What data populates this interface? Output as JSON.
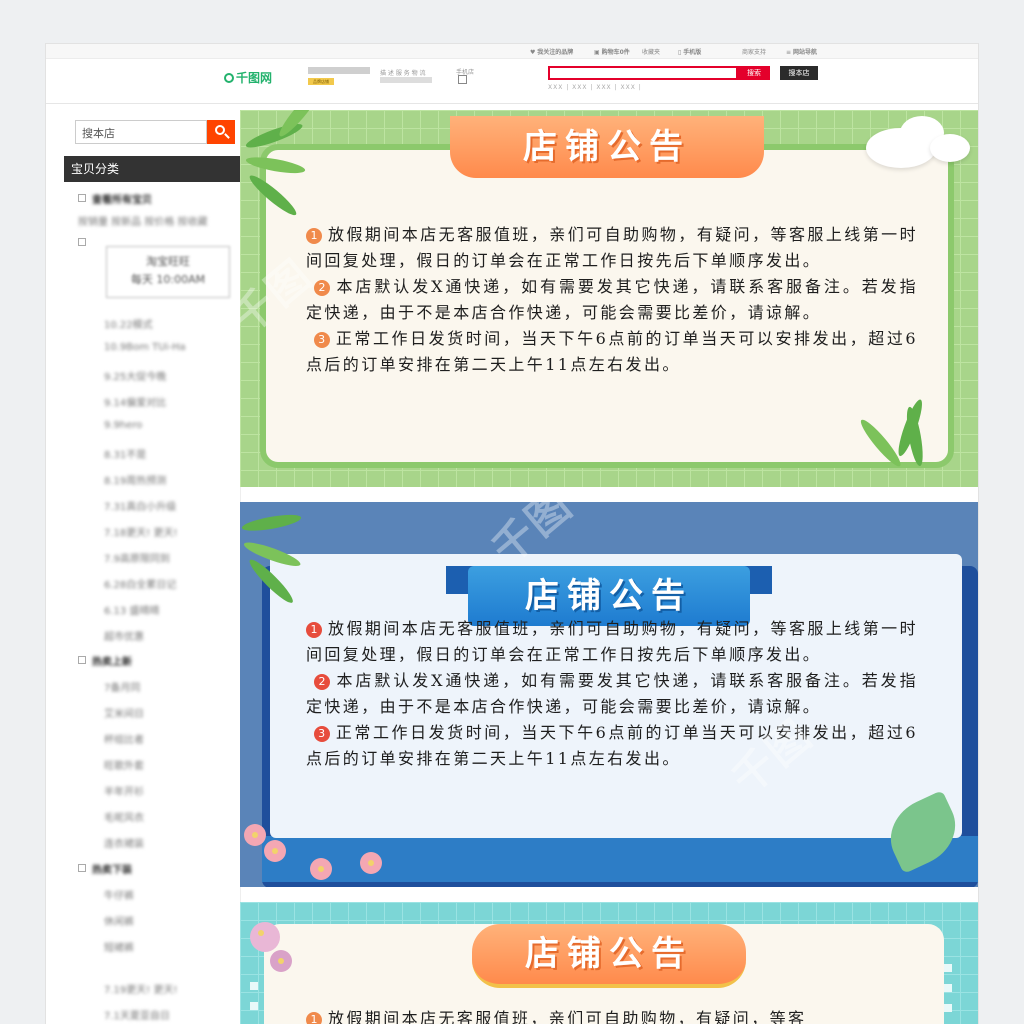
{
  "topnav": {
    "favorites": "我关注的品牌",
    "cart": "购物车0件",
    "collect": "收藏夹",
    "mobile": "手机版",
    "seller": "商家支持",
    "sitemap": "网站导航"
  },
  "header": {
    "logo": "千图网",
    "shop_badge": "品牌店铺",
    "shop_info": "描 述 服 务 物 流",
    "mobile_shop": "手机店",
    "search_placeholder": "",
    "search_button": "搜索",
    "shop_search_button": "搜本店",
    "hot_words": "XXX | XXX | XXX | XXX |"
  },
  "sidebar": {
    "search_placeholder": "搜本店",
    "category_title": "宝贝分类",
    "rows": [
      {
        "label": "查看所有宝贝",
        "sub": false
      },
      {
        "label": "按销量 按新品 按价格 按收藏",
        "sub": true
      },
      {
        "label": "10.22模式",
        "sub": true
      },
      {
        "label": "10.9Bom TUi-Ha",
        "sub": true
      },
      {
        "label": "9.25大促今晚",
        "sub": true
      },
      {
        "label": "9.14偏爱对比",
        "sub": true
      },
      {
        "label": "9.9hero",
        "sub": true
      },
      {
        "label": "8.31不是",
        "sub": true
      },
      {
        "label": "8.19周热预测",
        "sub": true
      },
      {
        "label": "7.31真白小升级",
        "sub": true
      },
      {
        "label": "7.18更天! 更天!",
        "sub": true
      },
      {
        "label": "7.9高原限同到",
        "sub": true
      },
      {
        "label": "6.28白全累日记",
        "sub": true
      },
      {
        "label": "6.13 盛晴晴",
        "sub": true
      },
      {
        "label": "超市优惠",
        "sub": true
      },
      {
        "label": "热卖上新",
        "sub": false
      },
      {
        "label": "7备月同",
        "sub": true
      },
      {
        "label": "艾米间日",
        "sub": true
      },
      {
        "label": "杯组比者",
        "sub": true
      },
      {
        "label": "旺歌外套",
        "sub": true
      },
      {
        "label": "半年开衫",
        "sub": true
      },
      {
        "label": "毛呢风衣",
        "sub": true
      },
      {
        "label": "连衣裙装",
        "sub": true
      },
      {
        "label": "热卖下装",
        "sub": false
      },
      {
        "label": "牛仔裤",
        "sub": true
      },
      {
        "label": "休闲裤",
        "sub": true
      },
      {
        "label": "短裙裤",
        "sub": true
      },
      {
        "label": "7.19更天! 更天!",
        "sub": true
      },
      {
        "label": "7.1天夏亚自日",
        "sub": true
      }
    ],
    "box_line1": "淘宝旺旺",
    "box_line2": "每天 10:00AM"
  },
  "notices": {
    "title": "店铺公告",
    "items": [
      {
        "num": "1",
        "text": "放假期间本店无客服值班，亲们可自助购物，有疑问，等客服上线第一时间回复处理，假日的订单会在正常工作日按先后下单顺序发出。"
      },
      {
        "num": "2",
        "text": "本店默认发X通快递，如有需要发其它快递，请联系客服备注。若发指定快递，由于不是本店合作快递，可能会需要比差价，请谅解。"
      },
      {
        "num": "3",
        "text": "正常工作日发货时间，当天下午6点前的订单当天可以安排发出，超过6点后的订单安排在第二天上午11点左右发出。"
      }
    ],
    "partial_text": "放假期间本店无客服值班，亲们可自助购物，有疑问，等客"
  },
  "watermark": "千图",
  "colors": {
    "green_panel": "#a8d58a",
    "blue_panel": "#5a84b8",
    "teal_panel": "#7cd6d6",
    "orange_title": "#ff8a4c",
    "blue_title": "#1e7bd0",
    "search_red": "#e4002b",
    "shop_orange": "#ff4400"
  }
}
